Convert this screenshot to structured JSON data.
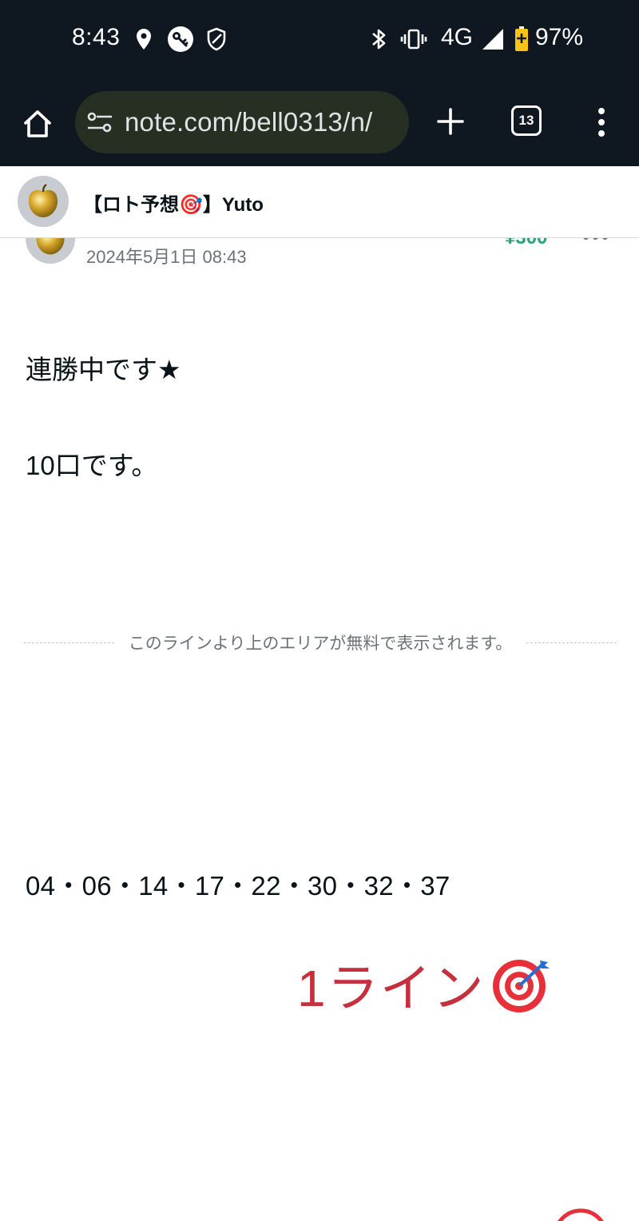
{
  "status_bar": {
    "time": "8:43",
    "network": "4G",
    "battery_percent": "97%",
    "icons": [
      "location-icon",
      "vpn-key-icon",
      "shield-icon",
      "bluetooth-icon",
      "vibrate-icon",
      "signal-icon",
      "battery-icon"
    ]
  },
  "browser": {
    "url": "note.com/bell0313/n/",
    "tab_count": "13",
    "icons": [
      "home-icon",
      "site-settings-icon",
      "new-tab-icon",
      "tab-switcher-icon",
      "more-menu-icon"
    ]
  },
  "note_header": {
    "title": "【ロト予想🎯】Yuto"
  },
  "article": {
    "date": "2024年5月1日 08:43",
    "price": "¥300",
    "paragraphs": [
      "連勝中です★",
      "10口です。"
    ],
    "free_line_text": "このラインより上のエリアが無料で表示されます。",
    "numbers": "04・06・14・17・22・30・32・37",
    "line_label": "1ライン"
  },
  "colors": {
    "system_bar": "#0f1720",
    "omnibox": "#262f22",
    "price_green": "#2aa37a",
    "line_red": "#c6303c",
    "text": "#08131a",
    "muted": "#6b7378"
  }
}
